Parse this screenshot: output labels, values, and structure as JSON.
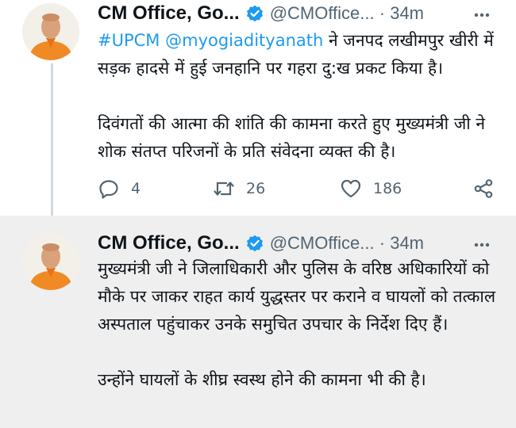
{
  "tweets": [
    {
      "name": "CM Office, Go...",
      "handle": "@CMOffice...",
      "time": "· 34m",
      "hashtag": "#UPCM",
      "mention": "@myogiadityanath",
      "para1_rest": " ने जनपद लखीमपुर खीरी में सड़क हादसे में हुई जनहानि पर गहरा दु:ख प्रकट किया है।",
      "para2": "दिवंगतों की आत्मा की शांति की कामना करते हुए मुख्यमंत्री जी ने  शोक संतप्त परिजनों के प्रति संवेदना व्यक्त की है।",
      "replies": "4",
      "retweets": "26",
      "likes": "186"
    },
    {
      "name": "CM Office, Go...",
      "handle": "@CMOffice...",
      "time": "· 34m",
      "para1": "मुख्यमंत्री जी ने जिलाधिकारी और पुलिस के वरिष्ठ अधिकारियों को मौके पर जाकर राहत कार्य युद्धस्तर पर कराने व घायलों को तत्काल अस्पताल पहुंचाकर उनके समुचित उपचार के निर्देश दिए हैं।",
      "para2": "उन्होंने घायलों के शीघ्र स्वस्थ होने की कामना भी की है।"
    }
  ],
  "colors": {
    "link": "#1d9bf0",
    "muted": "#536471",
    "verified": "#1d9bf0",
    "saffron": "#f08a24"
  },
  "icons": [
    "verified-badge-icon",
    "more-icon",
    "reply-icon",
    "retweet-icon",
    "like-icon",
    "share-icon"
  ]
}
